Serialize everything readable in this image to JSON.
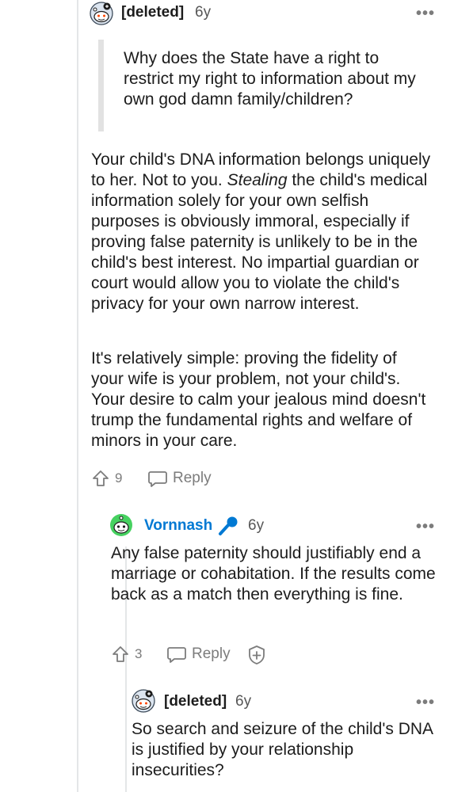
{
  "comment1": {
    "username": "[deleted]",
    "time": "6y",
    "more": "•••",
    "quote": "Why does the State have a right to restrict my right to information about my own god damn family/children?",
    "para1_before": "Your child's DNA information belongs uniquely to her. Not to you. ",
    "para1_em": "Stealing",
    "para1_after": " the child's medical information solely for your own selfish purposes is obviously immoral, especially if proving false paternity is unlikely to be in the child's best interest. No impartial guardian or court would allow you to violate the child's privacy for your own narrow interest.",
    "para2": "It's relatively simple: proving the fidelity of your wife is your problem, not your child's. Your desire to calm your jealous mind doesn't trump the fundamental rights and welfare of minors in your care.",
    "upvotes": "9",
    "reply_label": "Reply"
  },
  "comment2": {
    "username": "Vornnash",
    "time": "6y",
    "more": "•••",
    "body": "Any false paternity should justifiably end a marriage or cohabitation. If the results come back as a match then everything is fine.",
    "upvotes": "3",
    "reply_label": "Reply"
  },
  "comment3": {
    "username": "[deleted]",
    "time": "6y",
    "more": "•••",
    "body": "So search and seizure of the child's DNA is justified by your relationship insecurities?"
  },
  "colors": {
    "username_link": "#0079d3",
    "mic_blue": "#0079d3",
    "avatar_teal": "#46d160",
    "meta_gray": "#7c7c7c",
    "thread_line": "#e4e6e8"
  }
}
